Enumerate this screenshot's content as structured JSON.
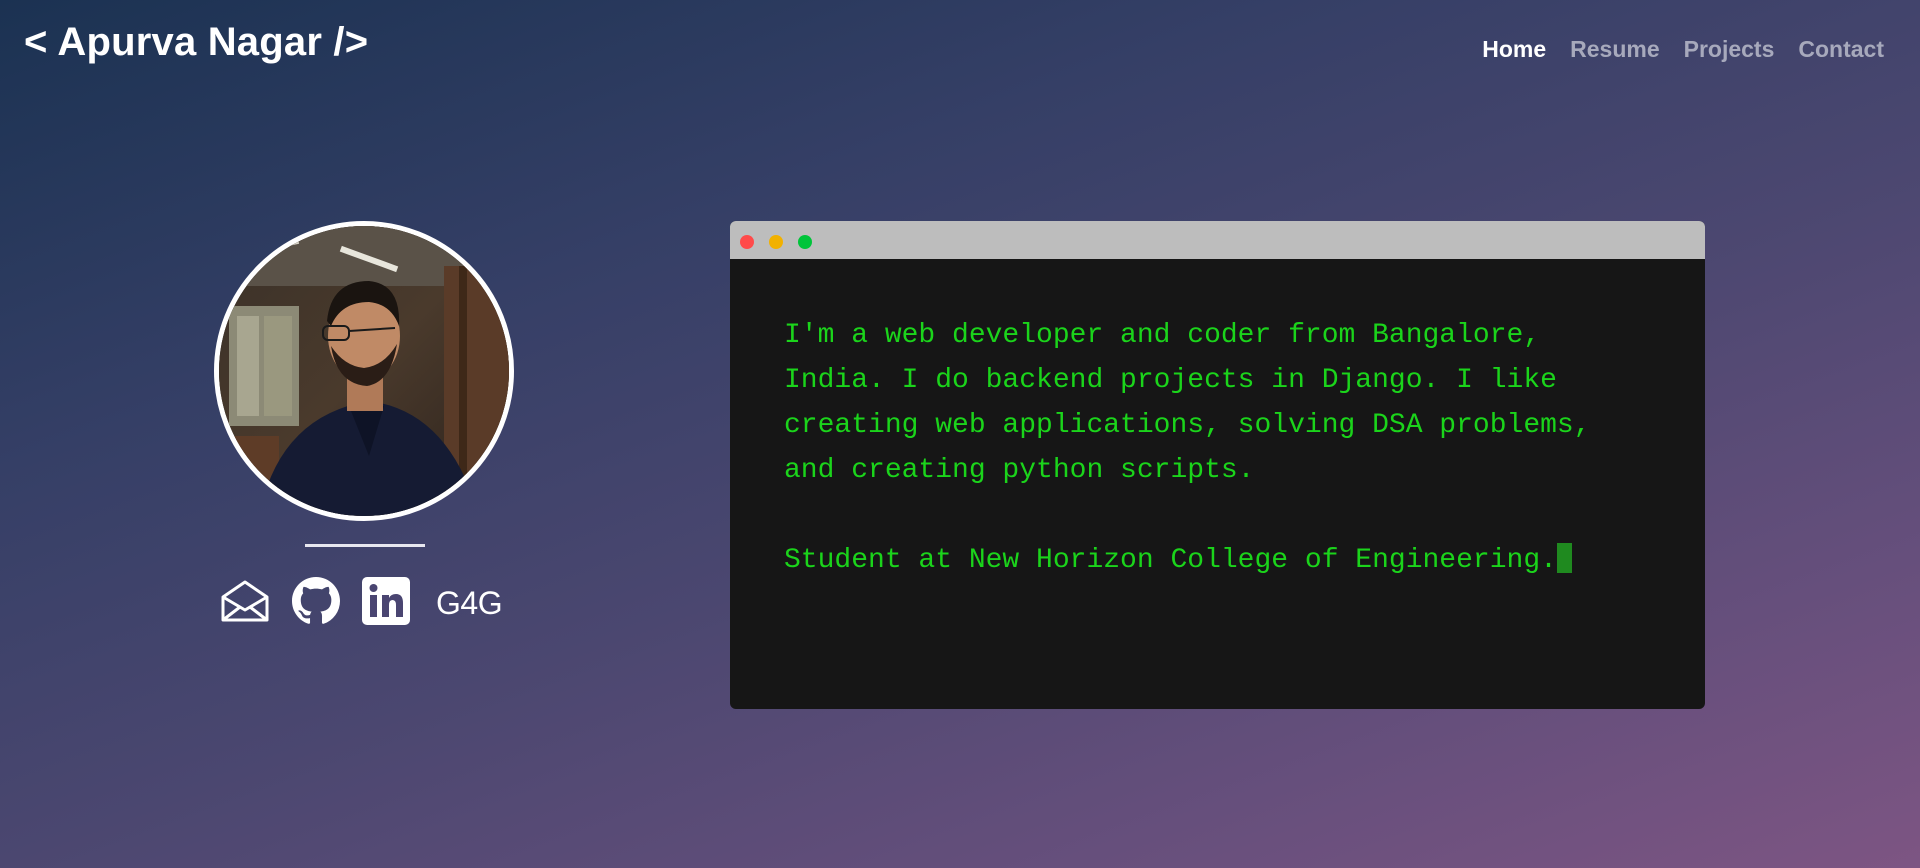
{
  "header": {
    "brand": "< Apurva Nagar />",
    "nav": [
      {
        "label": "Home",
        "active": true
      },
      {
        "label": "Resume",
        "active": false
      },
      {
        "label": "Projects",
        "active": false
      },
      {
        "label": "Contact",
        "active": false
      }
    ]
  },
  "profile": {
    "photo_icon": "profile-photo"
  },
  "socials": {
    "items": [
      {
        "icon": "mail-icon"
      },
      {
        "icon": "github-icon"
      },
      {
        "icon": "linkedin-icon"
      },
      {
        "icon": "g4g-icon",
        "label": "G4G"
      }
    ]
  },
  "terminal": {
    "lines": [
      "I'm a web developer and coder from Bangalore,",
      "India. I do backend projects in Django. I like",
      "creating web applications, solving DSA problems,",
      "and creating python scripts."
    ],
    "footer_line": "Student at New Horizon College of Engineering."
  },
  "colors": {
    "terminal_text": "#1bd41b",
    "terminal_bg": "#161616",
    "titlebar": "#bdbdbd",
    "dot_red": "#ff4a4a",
    "dot_yellow": "#f2b100",
    "dot_green": "#00c43a"
  }
}
